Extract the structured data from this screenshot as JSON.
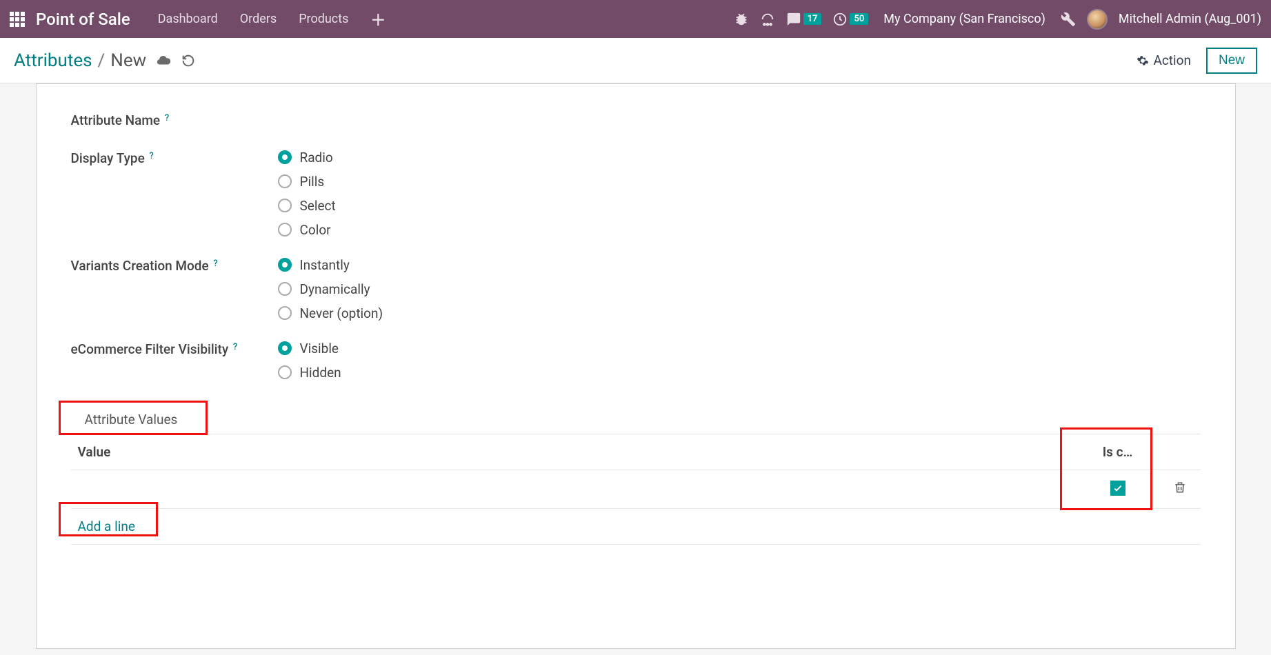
{
  "navbar": {
    "brand": "Point of Sale",
    "links": [
      "Dashboard",
      "Orders",
      "Products"
    ],
    "messaging_badge": "17",
    "activities_badge": "50",
    "company": "My Company (San Francisco)",
    "user": "Mitchell Admin (Aug_001)"
  },
  "toolbar": {
    "breadcrumb_root": "Attributes",
    "breadcrumb_sep": "/",
    "breadcrumb_current": "New",
    "action_label": "Action",
    "new_label": "New"
  },
  "form": {
    "fields": {
      "attribute_name": {
        "label": "Attribute Name"
      },
      "display_type": {
        "label": "Display Type",
        "options": [
          "Radio",
          "Pills",
          "Select",
          "Color"
        ],
        "selected": "Radio"
      },
      "variants_mode": {
        "label": "Variants Creation Mode",
        "options": [
          "Instantly",
          "Dynamically",
          "Never (option)"
        ],
        "selected": "Instantly"
      },
      "filter_visibility": {
        "label": "eCommerce Filter Visibility",
        "options": [
          "Visible",
          "Hidden"
        ],
        "selected": "Visible"
      }
    },
    "tab_label": "Attribute Values",
    "table": {
      "col_value": "Value",
      "col_isc": "Is c…",
      "rows": [
        {
          "value": "",
          "is_custom": true
        }
      ],
      "add_line": "Add a line"
    }
  },
  "help_marker": "?"
}
